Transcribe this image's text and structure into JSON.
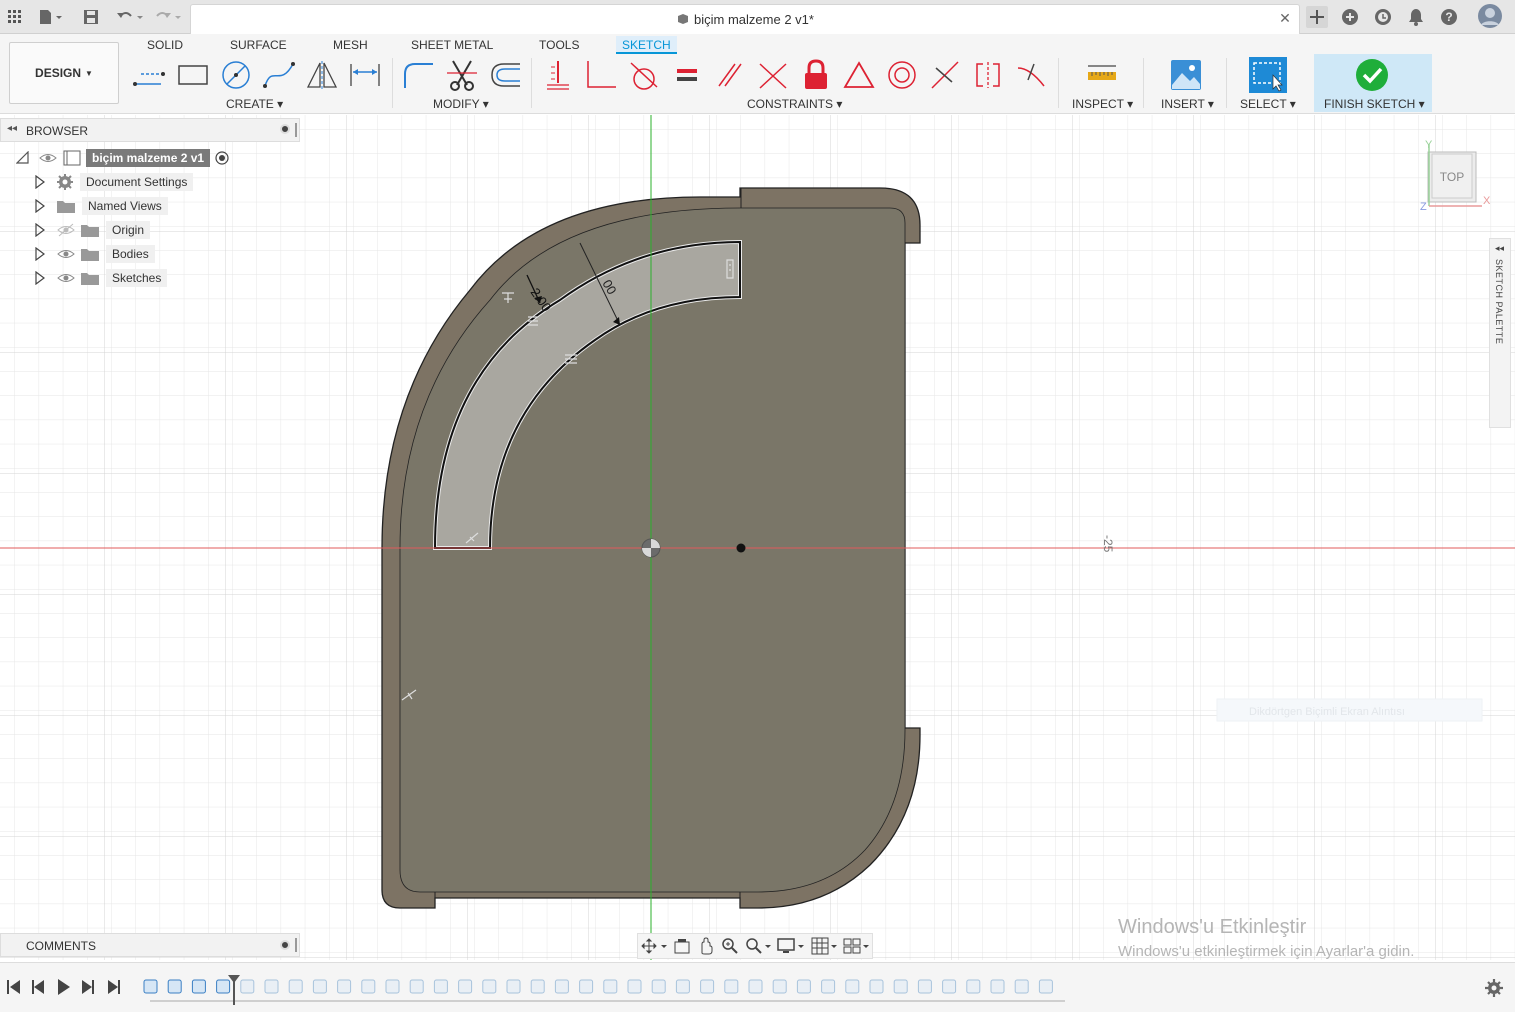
{
  "title_bar": {
    "doc_title": "biçim malzeme 2 v1*",
    "icons": [
      "apps-grid-icon",
      "file-icon",
      "save-icon",
      "undo-icon",
      "redo-icon",
      "new-tab-icon",
      "extensions-icon",
      "job-status-icon",
      "notifications-icon",
      "help-icon",
      "user-avatar-icon"
    ]
  },
  "ribbon": {
    "workspace": "DESIGN",
    "tabs": [
      "SOLID",
      "SURFACE",
      "MESH",
      "SHEET METAL",
      "TOOLS",
      "SKETCH"
    ],
    "active_tab": "SKETCH",
    "groups": {
      "create": "CREATE",
      "modify": "MODIFY",
      "constraints": "CONSTRAINTS",
      "inspect": "INSPECT",
      "insert": "INSERT",
      "select": "SELECT",
      "finish": "FINISH SKETCH"
    },
    "accent": "#0696d7"
  },
  "browser": {
    "header": "BROWSER",
    "root": "biçim malzeme 2 v1",
    "items": [
      "Document Settings",
      "Named Views",
      "Origin",
      "Bodies",
      "Sketches"
    ]
  },
  "comments": {
    "header": "COMMENTS"
  },
  "viewport": {
    "viewcube_face": "TOP",
    "axis_labels": {
      "x": "X",
      "y": "Y",
      "z": "Z"
    },
    "dimension_a": "2.00",
    "dimension_b": "00",
    "ruler_value": "-25",
    "faint_hint": "Dikdörtgen Biçimli Ekran Alıntısı"
  },
  "sketch_palette": {
    "label": "SKETCH PALETTE"
  },
  "watermark": {
    "line1": "Windows'u Etkinleştir",
    "line2": "Windows'u etkinleştirmek için Ayarlar'a gidin."
  }
}
